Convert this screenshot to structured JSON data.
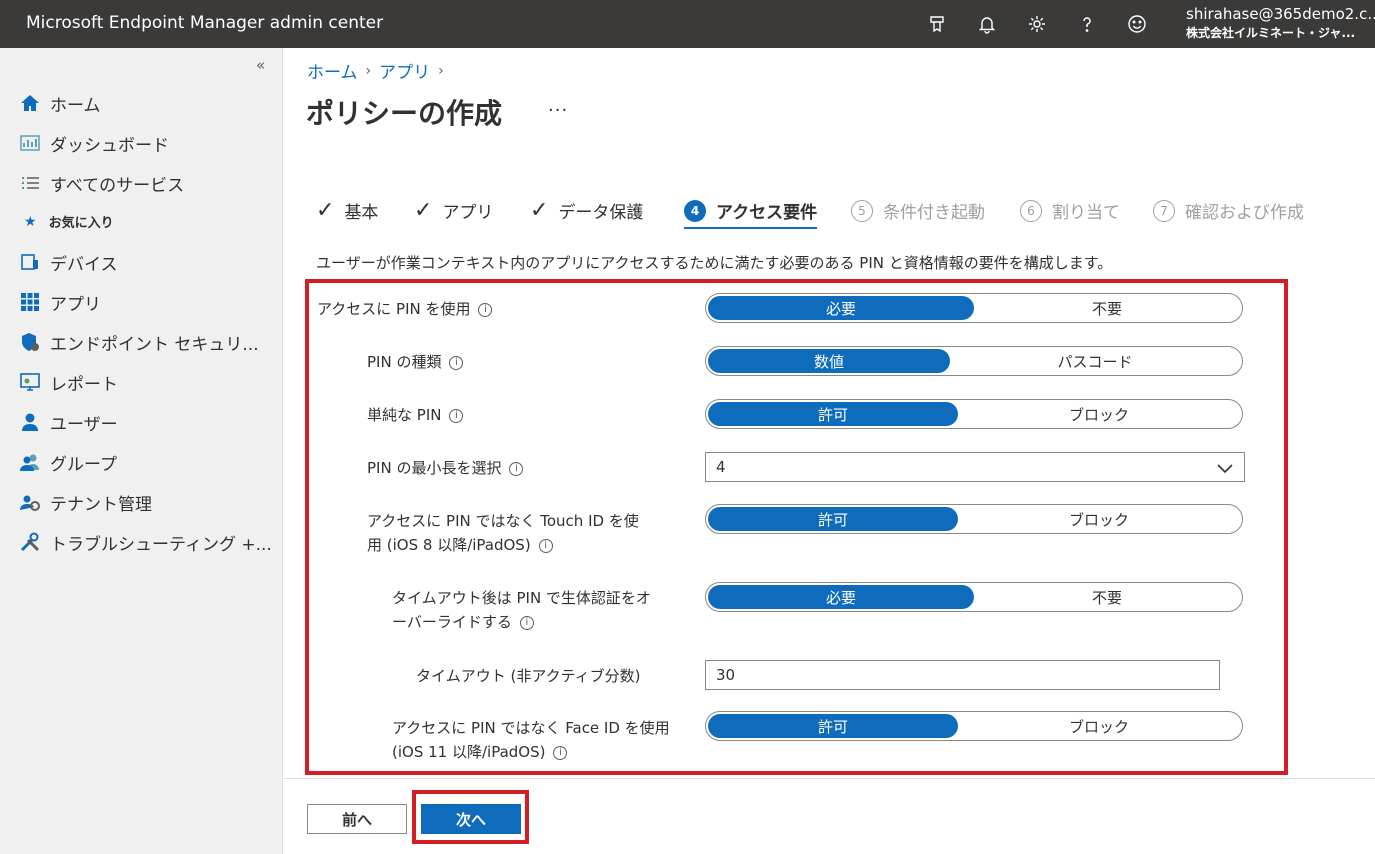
{
  "header": {
    "app_title": "Microsoft Endpoint Manager admin center",
    "icons": [
      "feedback-icon",
      "bell-icon",
      "gear-icon",
      "help-icon",
      "smiley-icon"
    ],
    "account_email": "shirahase@365demo2.c...",
    "account_org": "株式会社イルミネート・ジャ..."
  },
  "sidebar": {
    "collapse": "«",
    "favorites_label": "お気に入り",
    "items": [
      {
        "label": "ホーム",
        "icon": "home-icon"
      },
      {
        "label": "ダッシュボード",
        "icon": "dashboard-icon"
      },
      {
        "label": "すべてのサービス",
        "icon": "list-icon"
      },
      {
        "label": "デバイス",
        "icon": "devices-icon"
      },
      {
        "label": "アプリ",
        "icon": "apps-icon"
      },
      {
        "label": "エンドポイント セキュリ...",
        "icon": "shield-icon"
      },
      {
        "label": "レポート",
        "icon": "reports-icon"
      },
      {
        "label": "ユーザー",
        "icon": "user-icon"
      },
      {
        "label": "グループ",
        "icon": "group-icon"
      },
      {
        "label": "テナント管理",
        "icon": "tenant-gear-icon"
      },
      {
        "label": "トラブルシューティング +...",
        "icon": "tools-icon"
      }
    ]
  },
  "breadcrumb": [
    "ホーム",
    "アプリ"
  ],
  "page_title": "ポリシーの作成",
  "title_more": "···",
  "steps": [
    {
      "label": "基本",
      "state": "done"
    },
    {
      "label": "アプリ",
      "state": "done"
    },
    {
      "label": "データ保護",
      "state": "done"
    },
    {
      "num": "4",
      "label": "アクセス要件",
      "state": "active"
    },
    {
      "num": "5",
      "label": "条件付き起動",
      "state": "pending"
    },
    {
      "num": "6",
      "label": "割り当て",
      "state": "pending"
    },
    {
      "num": "7",
      "label": "確認および作成",
      "state": "pending"
    }
  ],
  "description": "ユーザーが作業コンテキスト内のアプリにアクセスするために満たす必要のある PIN と資格情報の要件を構成します。",
  "settings": {
    "pin_access": {
      "label": "アクセスに PIN を使用",
      "options": [
        "必要",
        "不要"
      ],
      "selected": "必要"
    },
    "pin_type": {
      "label": "PIN の種類",
      "options": [
        "数値",
        "パスコード"
      ],
      "selected": "数値"
    },
    "simple_pin": {
      "label": "単純な PIN",
      "options": [
        "許可",
        "ブロック"
      ],
      "selected": "許可"
    },
    "min_length": {
      "label": "PIN の最小長を選択",
      "value": "4"
    },
    "touch_id": {
      "label_line1": "アクセスに PIN ではなく Touch ID を使",
      "label_line2": "用 (iOS 8 以降/iPadOS)",
      "options": [
        "許可",
        "ブロック"
      ],
      "selected": "許可"
    },
    "biometric_override": {
      "label_line1": "タイムアウト後は PIN で生体認証をオ",
      "label_line2": "ーバーライドする",
      "options": [
        "必要",
        "不要"
      ],
      "selected": "必要"
    },
    "timeout": {
      "label": "タイムアウト (非アクティブ分数)",
      "value": "30"
    },
    "face_id": {
      "label_line1": "アクセスに PIN ではなく Face ID を使用",
      "label_line2": "(iOS 11 以降/iPadOS)",
      "options": [
        "許可",
        "ブロック"
      ],
      "selected": "許可"
    }
  },
  "footer": {
    "prev_label": "前へ",
    "next_label": "次へ"
  },
  "colors": {
    "accent": "#0f6cbd",
    "highlight": "#d41e25",
    "topbar": "#3b3a39"
  }
}
